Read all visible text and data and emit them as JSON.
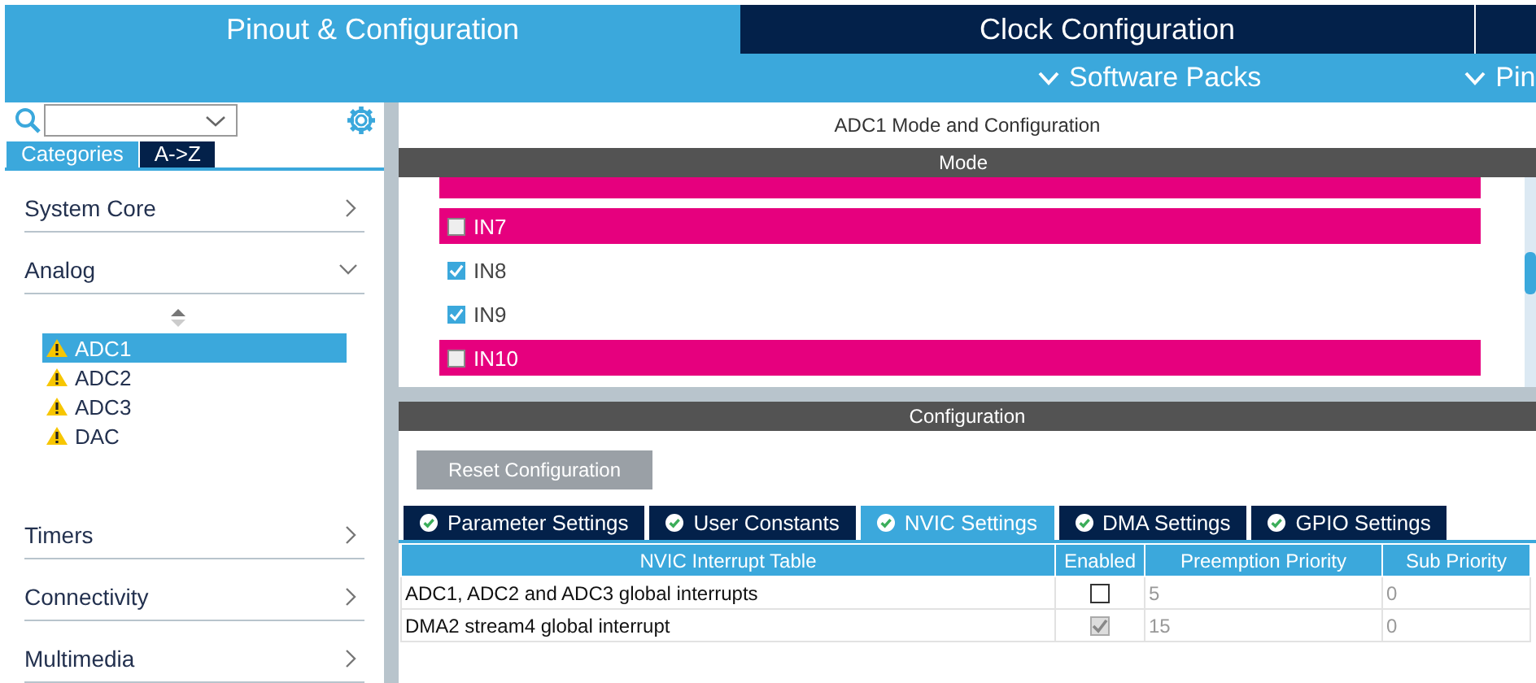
{
  "header": {
    "tabs": [
      {
        "label": "Pinout & Configuration",
        "selected": true
      },
      {
        "label": "Clock Configuration",
        "selected": false
      }
    ],
    "menus": [
      {
        "label": "Software Packs"
      },
      {
        "label": "Pin"
      }
    ]
  },
  "sidebar": {
    "tabs": [
      {
        "label": "Categories",
        "selected": true
      },
      {
        "label": "A->Z",
        "selected": false
      }
    ],
    "categories": [
      {
        "label": "System Core",
        "expanded": false
      },
      {
        "label": "Analog",
        "expanded": true,
        "items": [
          {
            "label": "ADC1",
            "selected": true,
            "warning": true
          },
          {
            "label": "ADC2",
            "selected": false,
            "warning": true
          },
          {
            "label": "ADC3",
            "selected": false,
            "warning": true
          },
          {
            "label": "DAC",
            "selected": false,
            "warning": true
          }
        ]
      },
      {
        "label": "Timers",
        "expanded": false
      },
      {
        "label": "Connectivity",
        "expanded": false
      },
      {
        "label": "Multimedia",
        "expanded": false
      }
    ]
  },
  "panel": {
    "title": "ADC1 Mode and Configuration",
    "mode_header": "Mode",
    "mode_items": [
      {
        "label": "IN7",
        "checked": false,
        "highlighted": true
      },
      {
        "label": "IN8",
        "checked": true,
        "highlighted": false
      },
      {
        "label": "IN9",
        "checked": true,
        "highlighted": false
      },
      {
        "label": "IN10",
        "checked": false,
        "highlighted": true
      }
    ],
    "config_header": "Configuration",
    "reset_button": "Reset Configuration",
    "tabs": [
      {
        "label": "Parameter Settings",
        "selected": false
      },
      {
        "label": "User Constants",
        "selected": false
      },
      {
        "label": "NVIC Settings",
        "selected": true
      },
      {
        "label": "DMA Settings",
        "selected": false
      },
      {
        "label": "GPIO Settings",
        "selected": false
      }
    ],
    "table": {
      "columns": [
        "NVIC Interrupt Table",
        "Enabled",
        "Preemption Priority",
        "Sub Priority"
      ],
      "rows": [
        {
          "name": "ADC1, ADC2 and ADC3 global interrupts",
          "enabled": false,
          "disabled": false,
          "preemption": "5",
          "sub": "0"
        },
        {
          "name": "DMA2 stream4 global interrupt",
          "enabled": true,
          "disabled": true,
          "preemption": "15",
          "sub": "0"
        }
      ]
    }
  }
}
